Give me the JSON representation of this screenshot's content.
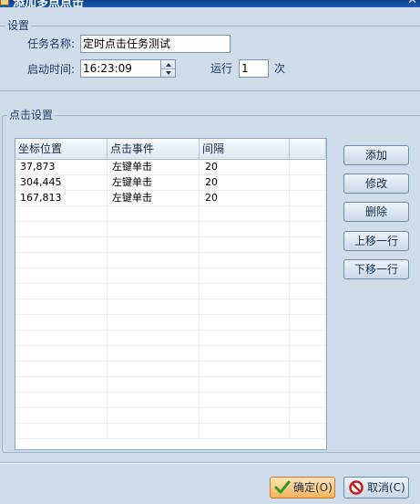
{
  "window": {
    "title": "添加多点点击"
  },
  "settings": {
    "legend": "设置",
    "task_name_label": "任务名称:",
    "task_name_value": "定时点击任务测试",
    "start_time_label": "启动时间:",
    "start_time_value": "16:23:09",
    "run_label": "运行",
    "run_value": "1",
    "run_unit": "次"
  },
  "click_settings": {
    "legend": "点击设置",
    "columns": [
      "坐标位置",
      "点击事件",
      "间隔",
      ""
    ],
    "rows": [
      [
        "37,873",
        "左键单击",
        "20"
      ],
      [
        "304,445",
        "左键单击",
        "20"
      ],
      [
        "167,813",
        "左键单击",
        "20"
      ]
    ],
    "buttons": {
      "add": "添加",
      "modify": "修改",
      "delete": "删除",
      "move_up": "上移一行",
      "move_down": "下移一行"
    }
  },
  "footer": {
    "ok_label": "确定(O)",
    "cancel_label": "取消(C)"
  },
  "colors": {
    "window_bg": "#cfdcea",
    "title_bar": "#1c5cb4",
    "ok_button": "#f7b35a",
    "ok_icon": "#2e9a2e",
    "cancel_icon": "#c81e1e"
  }
}
